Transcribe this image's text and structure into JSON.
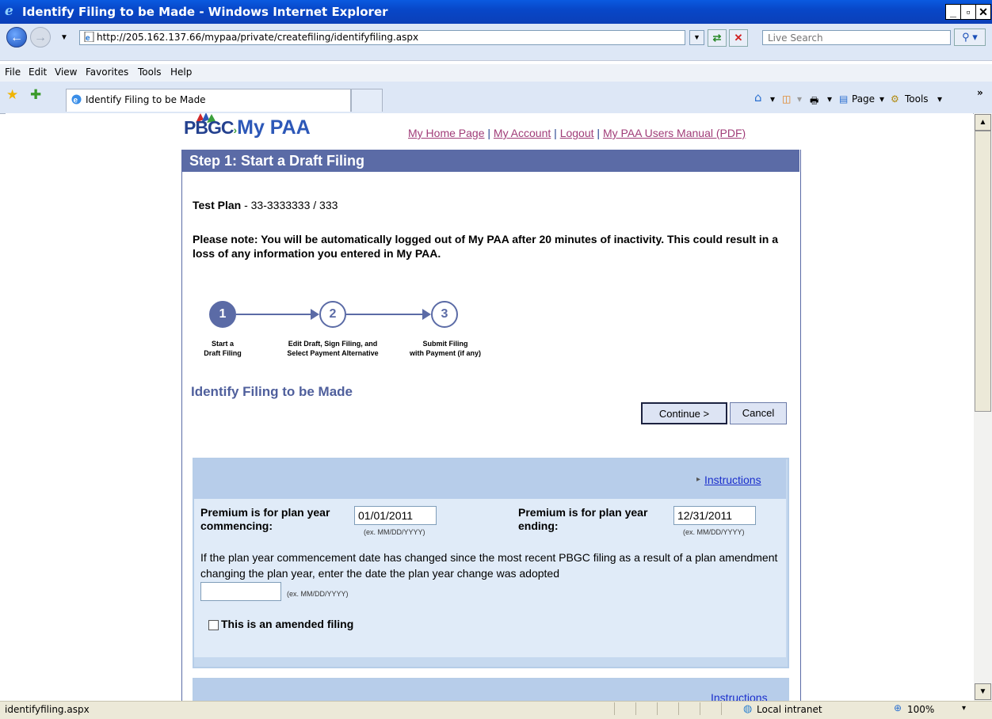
{
  "window": {
    "title": "Identify Filing to be Made - Windows Internet Explorer"
  },
  "address": {
    "url": "http://205.162.137.66/mypaa/private/createfiling/identifyfiling.aspx",
    "search_placeholder": "Live Search"
  },
  "menu": [
    "File",
    "Edit",
    "View",
    "Favorites",
    "Tools",
    "Help"
  ],
  "tab": {
    "label": "Identify Filing to be Made"
  },
  "commands": {
    "page": "Page",
    "tools": "Tools"
  },
  "site": {
    "logo_pbgc": "PBGC",
    "logo_mypaa": "My PAA",
    "links": [
      "My Home Page",
      "My Account",
      "Logout",
      "My PAA Users Manual (PDF)"
    ]
  },
  "step_header": "Step 1: Start a Draft Filing",
  "plan": {
    "name": "Test Plan",
    "rest": " - 33-3333333 / 333"
  },
  "note": "Please note: You will be automatically logged out of My PAA after 20 minutes of inactivity. This could result in a loss of any information you entered in My PAA.",
  "steps": [
    {
      "num": "1",
      "label1": "Start a",
      "label2": "Draft Filing"
    },
    {
      "num": "2",
      "label1": "Edit Draft, Sign Filing, and",
      "label2": "Select Payment Alternative"
    },
    {
      "num": "3",
      "label1": "Submit Filing",
      "label2": "with Payment (if any)"
    }
  ],
  "section_title": "Identify Filing to be Made",
  "buttons": {
    "continue": "Continue >",
    "cancel": "Cancel"
  },
  "form": {
    "instructions": "Instructions",
    "commencing_label1": "Premium is for plan year",
    "commencing_label2": "commencing:",
    "commencing_value": "01/01/2011",
    "ending_label1": "Premium is for plan year",
    "ending_label2": "ending:",
    "ending_value": "12/31/2011",
    "date_hint": "(ex. MM/DD/YYYY)",
    "help_text": "If the plan year commencement date has changed since the most recent PBGC filing as a result of a plan amendment changing the plan year, enter the date the plan year change was adopted",
    "change_value": "",
    "amended_label": "This is an amended filing"
  },
  "second_instructions": "Instructions",
  "status": {
    "text": "identifyfiling.aspx",
    "zone": "Local intranet",
    "zoom": "100%"
  }
}
